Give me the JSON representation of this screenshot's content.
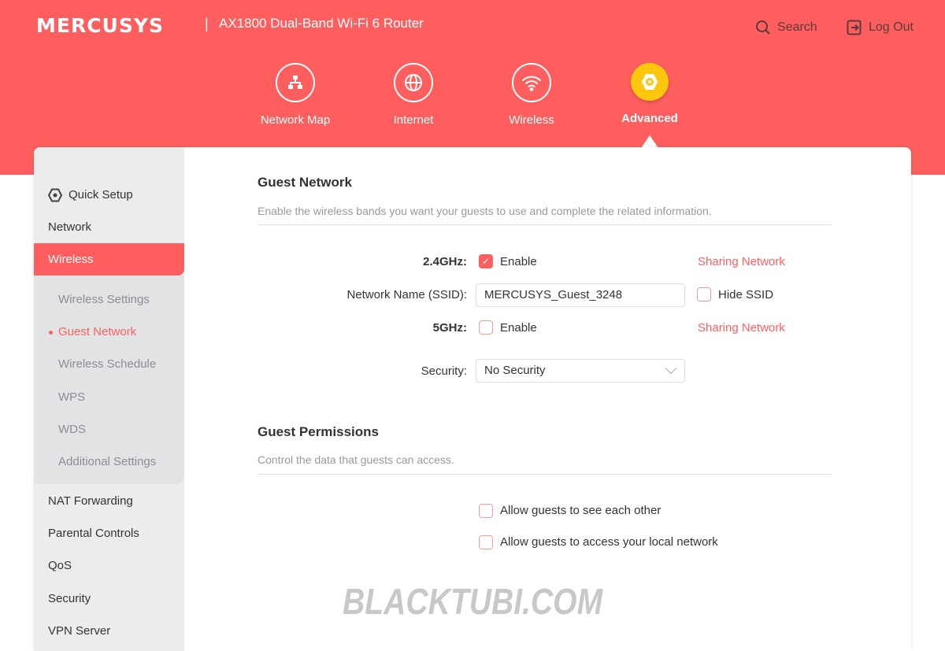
{
  "header": {
    "brand": "MERCUSYS",
    "separator": "|",
    "model": "AX1800 Dual-Band Wi-Fi 6 Router",
    "search": "Search",
    "logout": "Log Out"
  },
  "nav": [
    {
      "label": "Network Map",
      "icon": "network-map-icon"
    },
    {
      "label": "Internet",
      "icon": "globe-icon"
    },
    {
      "label": "Wireless",
      "icon": "wifi-icon"
    },
    {
      "label": "Advanced",
      "icon": "gear-icon",
      "active": true
    }
  ],
  "sidebar": {
    "items": [
      "Quick Setup",
      "Network",
      "Wireless",
      "NAT Forwarding",
      "Parental Controls",
      "QoS",
      "Security",
      "VPN Server"
    ],
    "sub": [
      "Wireless Settings",
      "Guest Network",
      "Wireless Schedule",
      "WPS",
      "WDS",
      "Additional Settings"
    ],
    "active_item": "Wireless",
    "active_sub": "Guest Network"
  },
  "guest": {
    "title": "Guest Network",
    "desc": "Enable the wireless bands you want your guests to use and complete the related information.",
    "band24_label": "2.4GHz:",
    "band24_enable": "Enable",
    "band24_checked": true,
    "sharing": "Sharing Network",
    "ssid_label": "Network Name (SSID):",
    "ssid_value": "MERCUSYS_Guest_3248",
    "hide_ssid": "Hide SSID",
    "hide_ssid_checked": false,
    "band5_label": "5GHz:",
    "band5_enable": "Enable",
    "band5_checked": false,
    "security_label": "Security:",
    "security_value": "No Security"
  },
  "permissions": {
    "title": "Guest Permissions",
    "desc": "Control the data that guests can access.",
    "see_each_other": "Allow guests to see each other",
    "access_local": "Allow guests to access your local network"
  },
  "watermark": "BLACKTUBI.COM",
  "colors": {
    "brand": "#fe5f5e",
    "active_nav": "#fcc70d"
  }
}
